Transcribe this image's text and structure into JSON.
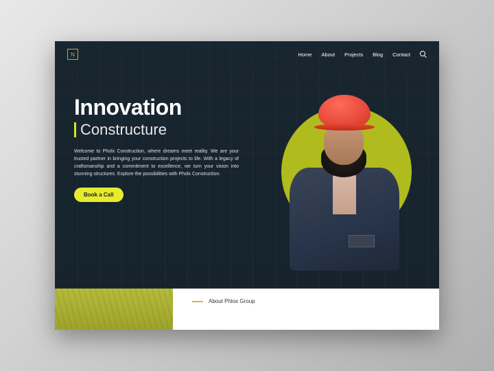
{
  "nav": {
    "logo_glyph": "N",
    "links": [
      "Home",
      "About",
      "Projects",
      "Blog",
      "Contact"
    ]
  },
  "hero": {
    "title": "Innovation",
    "subtitle": "Constructure",
    "description": "Welcome to Pholx Construction, where dreams meet reality. We are your trusted partner in bringing your construction projects to life. With a legacy of craftsmanship and a commitment to excellence, we turn your vision into stunning structures. Explore the possibilities with Pholx Construction.",
    "cta_label": "Book a Call"
  },
  "about": {
    "label": "About Phlox Group",
    "heading_partial": ""
  },
  "colors": {
    "accent_yellow": "#e6eb2e",
    "circle_green": "#b0bb1e",
    "helmet_red": "#d63426",
    "bg_dark": "#1a2832"
  }
}
